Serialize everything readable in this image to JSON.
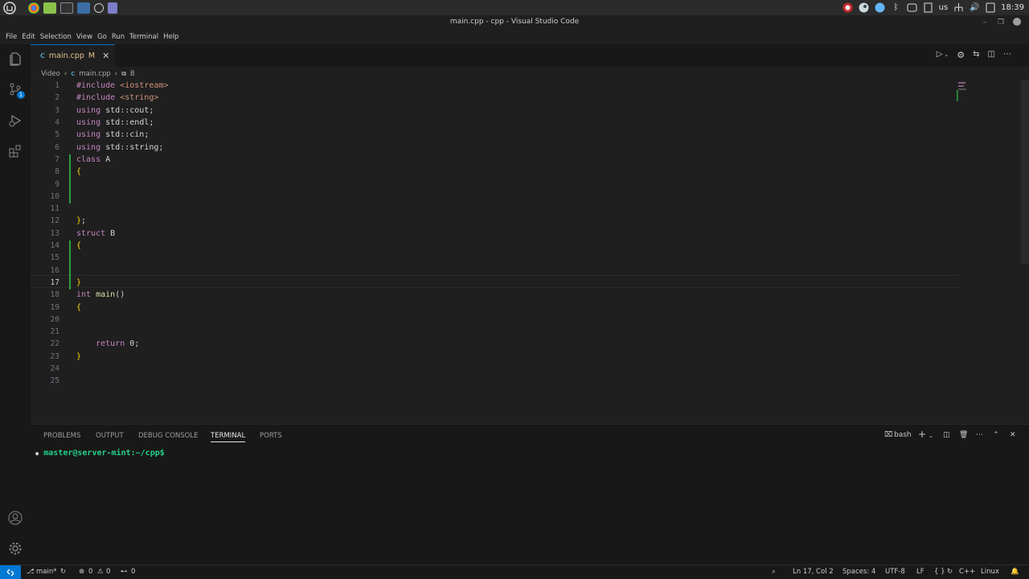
{
  "os": {
    "time": "18:39",
    "keyboard": "us"
  },
  "window": {
    "title": "main.cpp - cpp - Visual Studio Code"
  },
  "menu": {
    "items": [
      "File",
      "Edit",
      "Selection",
      "View",
      "Go",
      "Run",
      "Terminal",
      "Help"
    ]
  },
  "activity": {
    "source_control_badge": "1"
  },
  "tab": {
    "filename": "main.cpp",
    "status": "M"
  },
  "breadcrumbs": {
    "folder": "Video",
    "file": "main.cpp",
    "symbol": "B"
  },
  "editor": {
    "current_line": 17,
    "lines": [
      "#include <iostream>",
      "#include <string>",
      "using std::cout;",
      "using std::endl;",
      "using std::cin;",
      "using std::string;",
      "class A",
      "{",
      "",
      "",
      "",
      "};",
      "struct B",
      "{",
      "",
      "",
      "}",
      "int main()",
      "{",
      "",
      "",
      "    return 0;",
      "}",
      "",
      ""
    ]
  },
  "panel": {
    "tabs": [
      "PROBLEMS",
      "OUTPUT",
      "DEBUG CONSOLE",
      "TERMINAL",
      "PORTS"
    ],
    "active_tab": "TERMINAL",
    "shell": "bash",
    "prompt": "master@server-mint:~/cpp$"
  },
  "status": {
    "branch": "main*",
    "errors": "0",
    "warnings": "0",
    "ports": "0",
    "position": "Ln 17, Col 2",
    "spaces": "Spaces: 4",
    "encoding": "UTF-8",
    "eol": "LF",
    "language": "C++",
    "platform": "Linux"
  },
  "colors": {
    "accent": "#0078d4",
    "keyword": "#c586c0",
    "string": "#ce9178",
    "function": "#dcdcaa",
    "terminal_prompt": "#23d18b"
  }
}
